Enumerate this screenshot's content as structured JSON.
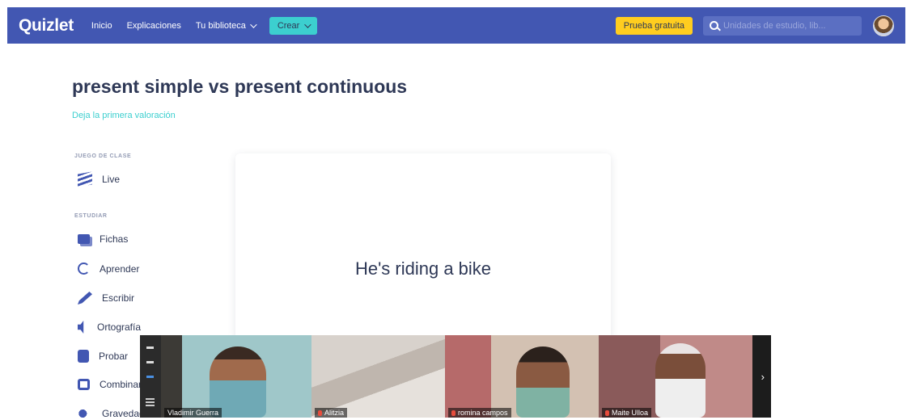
{
  "nav": {
    "logo": "Quizlet",
    "links": [
      "Inicio",
      "Explicaciones",
      "Tu biblioteca"
    ],
    "create_label": "Crear",
    "trial_label": "Prueba gratuita",
    "search_placeholder": "Unidades de estudio, lib..."
  },
  "set": {
    "title": "present simple vs present continuous",
    "rating_link": "Deja la primera valoración"
  },
  "sidebar": {
    "class_game_heading": "JUEGO DE CLASE",
    "live_label": "Live",
    "study_heading": "ESTUDIAR",
    "items": [
      "Fichas",
      "Aprender",
      "Escribir",
      "Ortografía",
      "Probar",
      "Combinar",
      "Gravedad"
    ]
  },
  "card": {
    "term": "He's riding a bike"
  },
  "video": {
    "participants": [
      "Vladimir Guerra",
      "Alitzia",
      "romina campos",
      "Maite Ulloa"
    ],
    "next_arrow": "›"
  }
}
